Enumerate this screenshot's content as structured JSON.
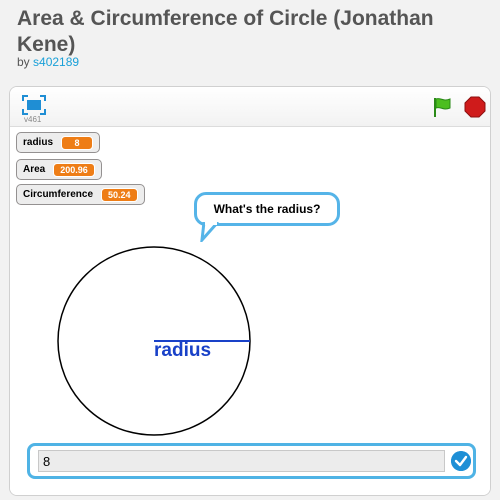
{
  "project": {
    "title": "Area & Circumference of Circle (Jonathan Kene)",
    "by_label": "by",
    "author": "s402189"
  },
  "player": {
    "version": "v461",
    "icons": {
      "fullscreen": "fullscreen-icon",
      "green_flag": "green-flag-icon",
      "stop": "stop-sign-icon"
    }
  },
  "monitors": [
    {
      "label": "radius",
      "value": "8"
    },
    {
      "label": "Area",
      "value": "200.96"
    },
    {
      "label": "Circumference",
      "value": "50.24"
    }
  ],
  "stage": {
    "speech_bubble": "What's the radius?",
    "radius_label": "radius"
  },
  "ask": {
    "input_value": "8",
    "submit_icon": "checkmark-icon"
  },
  "colors": {
    "accent_blue": "#4fb3e5",
    "monitor_value": "#ee7d16",
    "radius_text": "#1941c8"
  }
}
